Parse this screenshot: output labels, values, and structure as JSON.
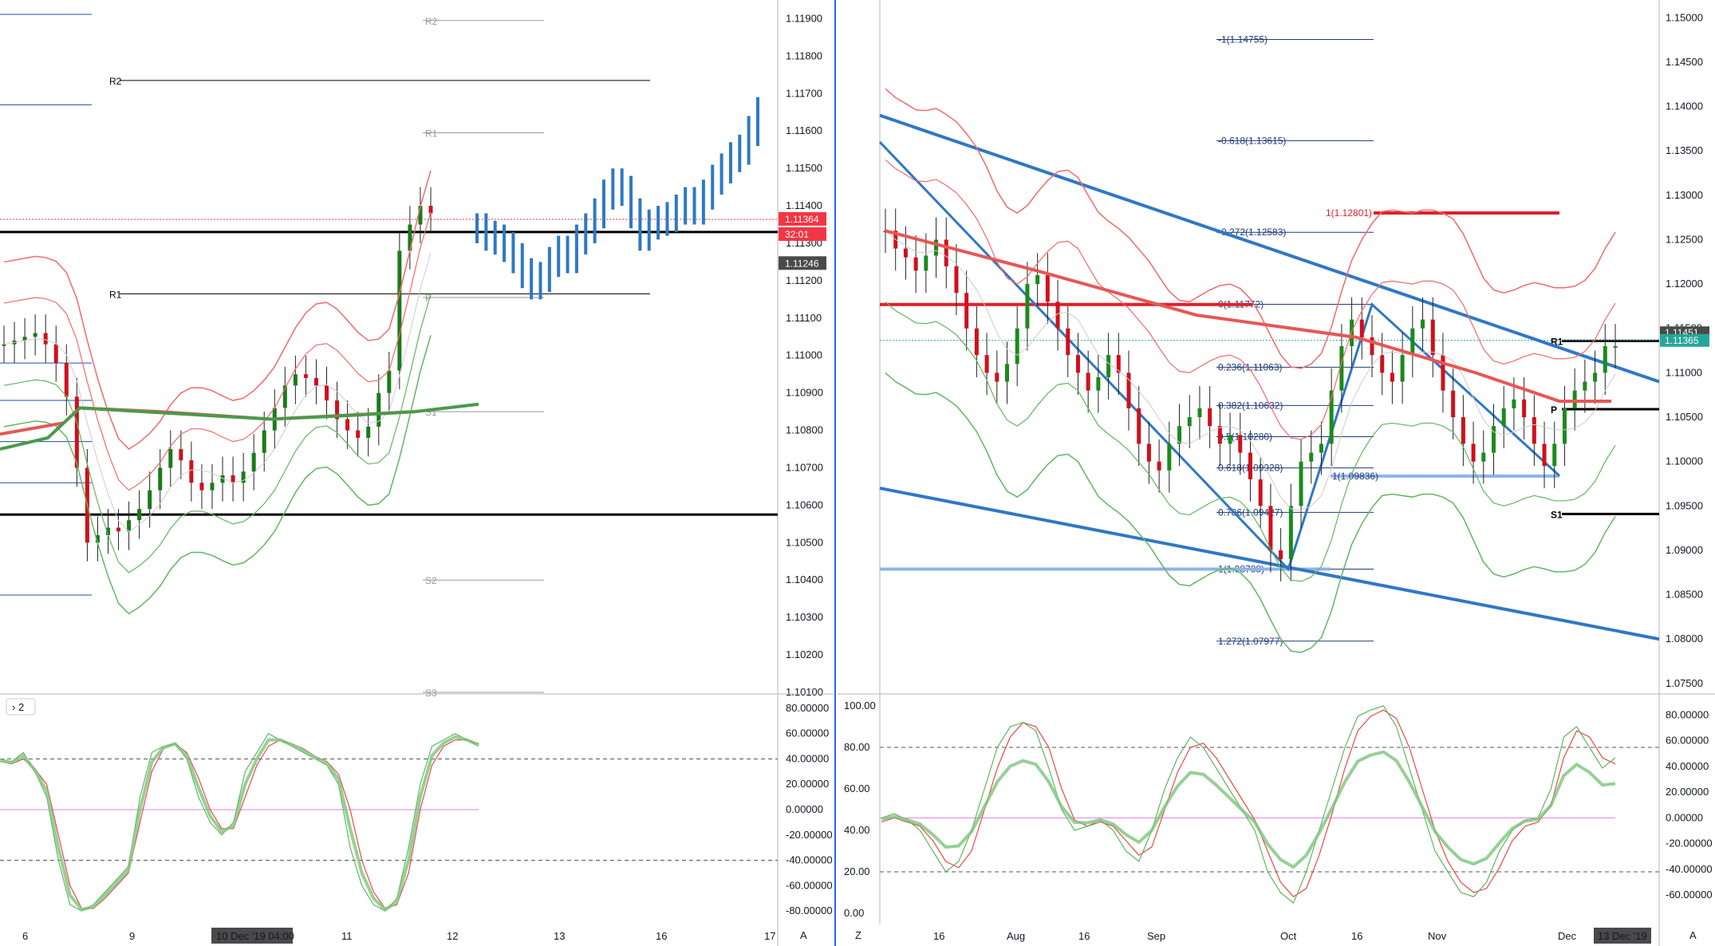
{
  "chart_data": [
    {
      "type": "line",
      "panel": "left-price",
      "time_axis": [
        "6",
        "9",
        "10 Dec '19  04:00",
        "11",
        "12",
        "13",
        "16",
        "17"
      ],
      "y_ticks": [
        "1.11900",
        "1.11800",
        "1.11700",
        "1.11600",
        "1.11500",
        "1.11400",
        "1.11300",
        "1.11200",
        "1.11100",
        "1.11000",
        "1.10900",
        "1.10800",
        "1.10700",
        "1.10600",
        "1.10500",
        "1.10400",
        "1.10300",
        "1.10200",
        "1.10100"
      ],
      "ylim": [
        1.101,
        1.1195
      ],
      "pivot_levels": [
        {
          "label": "R2",
          "value": 1.11735,
          "color": "#000000"
        },
        {
          "label": "R1",
          "value": 1.11165,
          "color": "#000000"
        },
        {
          "label": "R2",
          "value": 1.11895,
          "color": "#999999"
        },
        {
          "label": "R1",
          "value": 1.11595,
          "color": "#999999"
        },
        {
          "label": "P",
          "value": 1.11155,
          "color": "#999999"
        },
        {
          "label": "S1",
          "value": 1.1085,
          "color": "#999999"
        },
        {
          "label": "S2",
          "value": 1.104,
          "color": "#999999"
        },
        {
          "label": "S3",
          "value": 1.101,
          "color": "#999999"
        }
      ],
      "horizontal_lines": [
        1.1133,
        1.10575
      ],
      "price_tags": [
        {
          "text": "1.11364",
          "color": "#f23645"
        },
        {
          "text": "32:01",
          "color": "#f23645"
        },
        {
          "text": "1.11246",
          "color": "#4a4a4a"
        }
      ],
      "closes_history": [
        1.1103,
        1.1104,
        1.1105,
        1.1106,
        1.1103,
        1.1098,
        1.1089,
        1.107,
        1.105,
        1.1052,
        1.1054,
        1.1053,
        1.1056,
        1.1059,
        1.1064,
        1.107,
        1.1075,
        1.1072,
        1.1066,
        1.1064,
        1.1066,
        1.1068,
        1.1066,
        1.1069,
        1.1074,
        1.108,
        1.1086,
        1.1092,
        1.1095,
        1.1094,
        1.1092,
        1.1088,
        1.1083,
        1.108,
        1.1078,
        1.1081,
        1.109,
        1.1096,
        1.1128,
        1.1135,
        1.114,
        1.1138
      ],
      "projection": [
        1.1134,
        1.1132,
        1.1131,
        1.1129,
        1.1126,
        1.1122,
        1.1119,
        1.1121,
        1.1125,
        1.1128,
        1.1126,
        1.1131,
        1.1134,
        1.1138,
        1.1143,
        1.1146,
        1.1144,
        1.1138,
        1.1132,
        1.1135,
        1.1136,
        1.1137,
        1.1139,
        1.1141,
        1.1139,
        1.1143,
        1.1147,
        1.115,
        1.1153,
        1.1155,
        1.116,
        1.1165
      ]
    },
    {
      "type": "line",
      "panel": "left-oscillator",
      "indicator_label": "2",
      "y_ticks": [
        "80.00000",
        "60.00000",
        "40.00000",
        "20.00000",
        "0.00000",
        "-20.00000",
        "-40.00000",
        "-60.00000",
        "-80.00000"
      ],
      "ylim": [
        -90,
        90
      ],
      "dashed_levels": [
        40,
        -40
      ],
      "midline": 0,
      "series_fast": [
        40,
        38,
        45,
        30,
        10,
        -40,
        -75,
        -80,
        -75,
        -65,
        -55,
        -45,
        10,
        45,
        50,
        52,
        40,
        10,
        -10,
        -20,
        -10,
        30,
        45,
        60,
        55,
        50,
        45,
        40,
        35,
        20,
        -30,
        -60,
        -75,
        -80,
        -70,
        -30,
        20,
        50,
        55,
        60,
        55,
        50
      ],
      "series_slow": [
        38,
        36,
        40,
        32,
        20,
        -20,
        -60,
        -78,
        -78,
        -70,
        -60,
        -50,
        -10,
        30,
        48,
        52,
        45,
        25,
        0,
        -15,
        -15,
        10,
        35,
        50,
        55,
        52,
        48,
        42,
        38,
        28,
        0,
        -40,
        -65,
        -78,
        -75,
        -50,
        0,
        35,
        50,
        55,
        55,
        52
      ]
    },
    {
      "type": "line",
      "panel": "right-price",
      "time_axis": [
        "16",
        "Aug",
        "16",
        "Sep",
        "Oct",
        "16",
        "Nov",
        "Dec",
        "13 Dec '19"
      ],
      "y_ticks": [
        "1.15000",
        "1.14500",
        "1.14000",
        "1.13500",
        "1.13000",
        "1.12500",
        "1.12000",
        "1.11500",
        "1.11000",
        "1.10500",
        "1.10000",
        "1.09500",
        "1.09000",
        "1.08500",
        "1.08000",
        "1.07500"
      ],
      "ylim": [
        1.074,
        1.152
      ],
      "fib_levels": [
        {
          "label": "-1(1.14755)",
          "value": 1.14755
        },
        {
          "label": "-0.618(1.13615)",
          "value": 1.13615
        },
        {
          "label": "-0.272(1.12583)",
          "value": 1.12583
        },
        {
          "label": "0(1.11772)",
          "value": 1.11772
        },
        {
          "label": "0.236(1.11063)",
          "value": 1.11063
        },
        {
          "label": "0.382(1.10632)",
          "value": 1.10632
        },
        {
          "label": "0.5(1.10280)",
          "value": 1.1028
        },
        {
          "label": "0.618(1.09928)",
          "value": 1.09928
        },
        {
          "label": "0.786(1.09427)",
          "value": 1.09427
        },
        {
          "label": "1(1.08788)",
          "value": 1.08788
        },
        {
          "label": "1.272(1.07977)",
          "value": 1.07977
        }
      ],
      "red_level": {
        "label": "1(1.12801)",
        "value": 1.12801
      },
      "blue_level": {
        "label": "1(1.09836)",
        "value": 1.09836
      },
      "pivot_levels": [
        {
          "label": "R1",
          "value": 1.1136
        },
        {
          "label": "P",
          "value": 1.1059
        },
        {
          "label": "S1",
          "value": 1.0941
        }
      ],
      "price_tags": [
        {
          "text": "1.11451",
          "color": "#4a4a4a"
        },
        {
          "text": "1.11365",
          "color": "#26a69a"
        }
      ],
      "closes": [
        1.126,
        1.124,
        1.123,
        1.1215,
        1.1232,
        1.125,
        1.122,
        1.119,
        1.115,
        1.112,
        1.11,
        1.109,
        1.111,
        1.115,
        1.12,
        1.121,
        1.118,
        1.115,
        1.112,
        1.11,
        1.108,
        1.1095,
        1.112,
        1.11,
        1.106,
        1.102,
        1.1,
        1.099,
        1.102,
        1.104,
        1.105,
        1.106,
        1.104,
        1.102,
        1.103,
        1.101,
        1.098,
        1.095,
        1.09,
        1.089,
        1.095,
        1.1,
        1.101,
        1.102,
        1.108,
        1.113,
        1.116,
        1.114,
        1.112,
        1.11,
        1.109,
        1.112,
        1.115,
        1.116,
        1.112,
        1.108,
        1.105,
        1.102,
        1.1,
        1.101,
        1.104,
        1.106,
        1.107,
        1.105,
        1.102,
        1.0995,
        1.102,
        1.106,
        1.108,
        1.109,
        1.11,
        1.113,
        1.113
      ]
    },
    {
      "type": "line",
      "panel": "right-oscillator",
      "y_ticks_left": [
        "100.00",
        "80.00",
        "60.00",
        "40.00",
        "20.00",
        "0.00"
      ],
      "y_ticks_right": [
        "80.00000",
        "60.00000",
        "40.00000",
        "20.00000",
        "0.00000",
        "-20.00000",
        "-40.00000",
        "-60.00000"
      ],
      "ylim": [
        -5,
        105
      ],
      "dashed_levels": [
        80,
        20
      ],
      "midline": 46,
      "series_fast": [
        46,
        48,
        45,
        40,
        30,
        20,
        25,
        40,
        60,
        80,
        90,
        92,
        88,
        70,
        50,
        40,
        42,
        45,
        40,
        30,
        25,
        40,
        60,
        75,
        85,
        80,
        70,
        60,
        50,
        40,
        20,
        10,
        5,
        20,
        40,
        60,
        80,
        95,
        98,
        100,
        90,
        70,
        50,
        30,
        20,
        10,
        8,
        15,
        30,
        40,
        45,
        46,
        60,
        85,
        90,
        80,
        70,
        75
      ],
      "series_slow": [
        44,
        46,
        44,
        42,
        35,
        25,
        22,
        30,
        50,
        70,
        85,
        92,
        90,
        80,
        60,
        45,
        42,
        44,
        42,
        35,
        28,
        32,
        50,
        68,
        80,
        82,
        75,
        65,
        55,
        45,
        30,
        15,
        8,
        12,
        28,
        48,
        70,
        88,
        95,
        98,
        94,
        80,
        60,
        40,
        25,
        15,
        10,
        12,
        22,
        35,
        42,
        44,
        52,
        75,
        88,
        85,
        75,
        72
      ]
    }
  ],
  "ui": {
    "indicator_toggle": "› 2",
    "axis_mode_left": "A",
    "axis_mode_right": "A",
    "axis_mode_z": "Z"
  }
}
